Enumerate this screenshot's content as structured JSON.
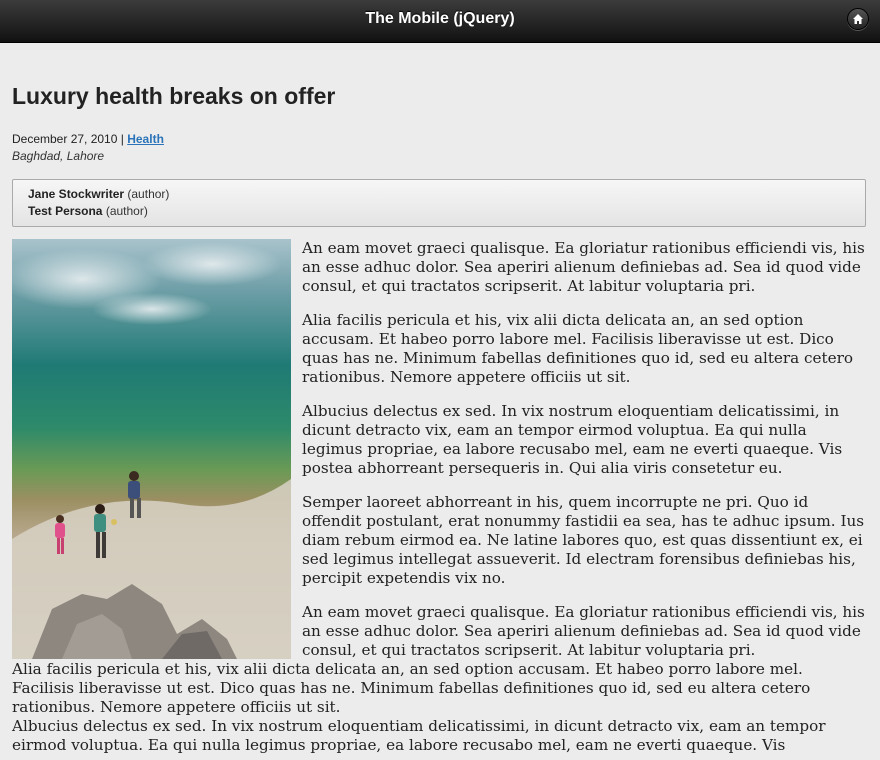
{
  "header": {
    "title": "The Mobile (jQuery)",
    "home_icon": "home-icon"
  },
  "article": {
    "title": "Luxury health breaks on offer",
    "date": "December 27, 2010",
    "separator": "|",
    "category": "Health",
    "location": "Baghdad, Lahore",
    "authors": [
      {
        "name": "Jane Stockwriter",
        "role": "(author)"
      },
      {
        "name": "Test Persona",
        "role": "(author)"
      }
    ],
    "paragraphs": [
      "An eam movet graeci qualisque. Ea gloriatur rationibus efficiendi vis, his an esse adhuc dolor. Sea aperiri alienum definiebas ad. Sea id quod vide consul, et qui tractatos scripserit. At labitur voluptaria pri.",
      "Alia facilis pericula et his, vix alii dicta delicata an, an sed option accusam. Et habeo porro labore mel. Facilisis liberavisse ut est. Dico quas has ne. Minimum fabellas definitiones quo id, sed eu altera cetero rationibus. Nemore appetere officiis ut sit.",
      "Albucius delectus ex sed. In vix nostrum eloquentiam delicatissimi, in dicunt detracto vix, eam an tempor eirmod voluptua. Ea qui nulla legimus propriae, ea labore recusabo mel, eam ne everti quaeque. Vis postea abhorreant persequeris in. Qui alia viris consetetur eu.",
      "Semper laoreet abhorreant in his, quem incorrupte ne pri. Quo id offendit postulant, erat nonummy fastidii ea sea, has te adhuc ipsum. Ius diam rebum eirmod ea. Ne latine labores quo, est quas dissentiunt ex, ei sed legimus intellegat assueverit. Id electram forensibus definiebas his, percipit expetendis vix no.",
      "An eam movet graeci qualisque. Ea gloriatur rationibus efficiendi vis, his an esse adhuc dolor. Sea aperiri alienum definiebas ad. Sea id quod vide consul, et qui tractatos scripserit. At labitur voluptaria pri.",
      "Alia facilis pericula et his, vix alii dicta delicata an, an sed option accusam. Et habeo porro labore mel. Facilisis liberavisse ut est. Dico quas has ne. Minimum fabellas definitiones quo id, sed eu altera cetero rationibus. Nemore appetere officiis ut sit.",
      "Albucius delectus ex sed. In vix nostrum eloquentiam delicatissimi, in dicunt detracto vix, eam an tempor eirmod voluptua. Ea qui nulla legimus propriae, ea labore recusabo mel, eam ne everti quaeque. Vis"
    ]
  },
  "colors": {
    "header_bg": "#1a1a1a",
    "page_bg": "#ececec",
    "link": "#2a73b8"
  }
}
